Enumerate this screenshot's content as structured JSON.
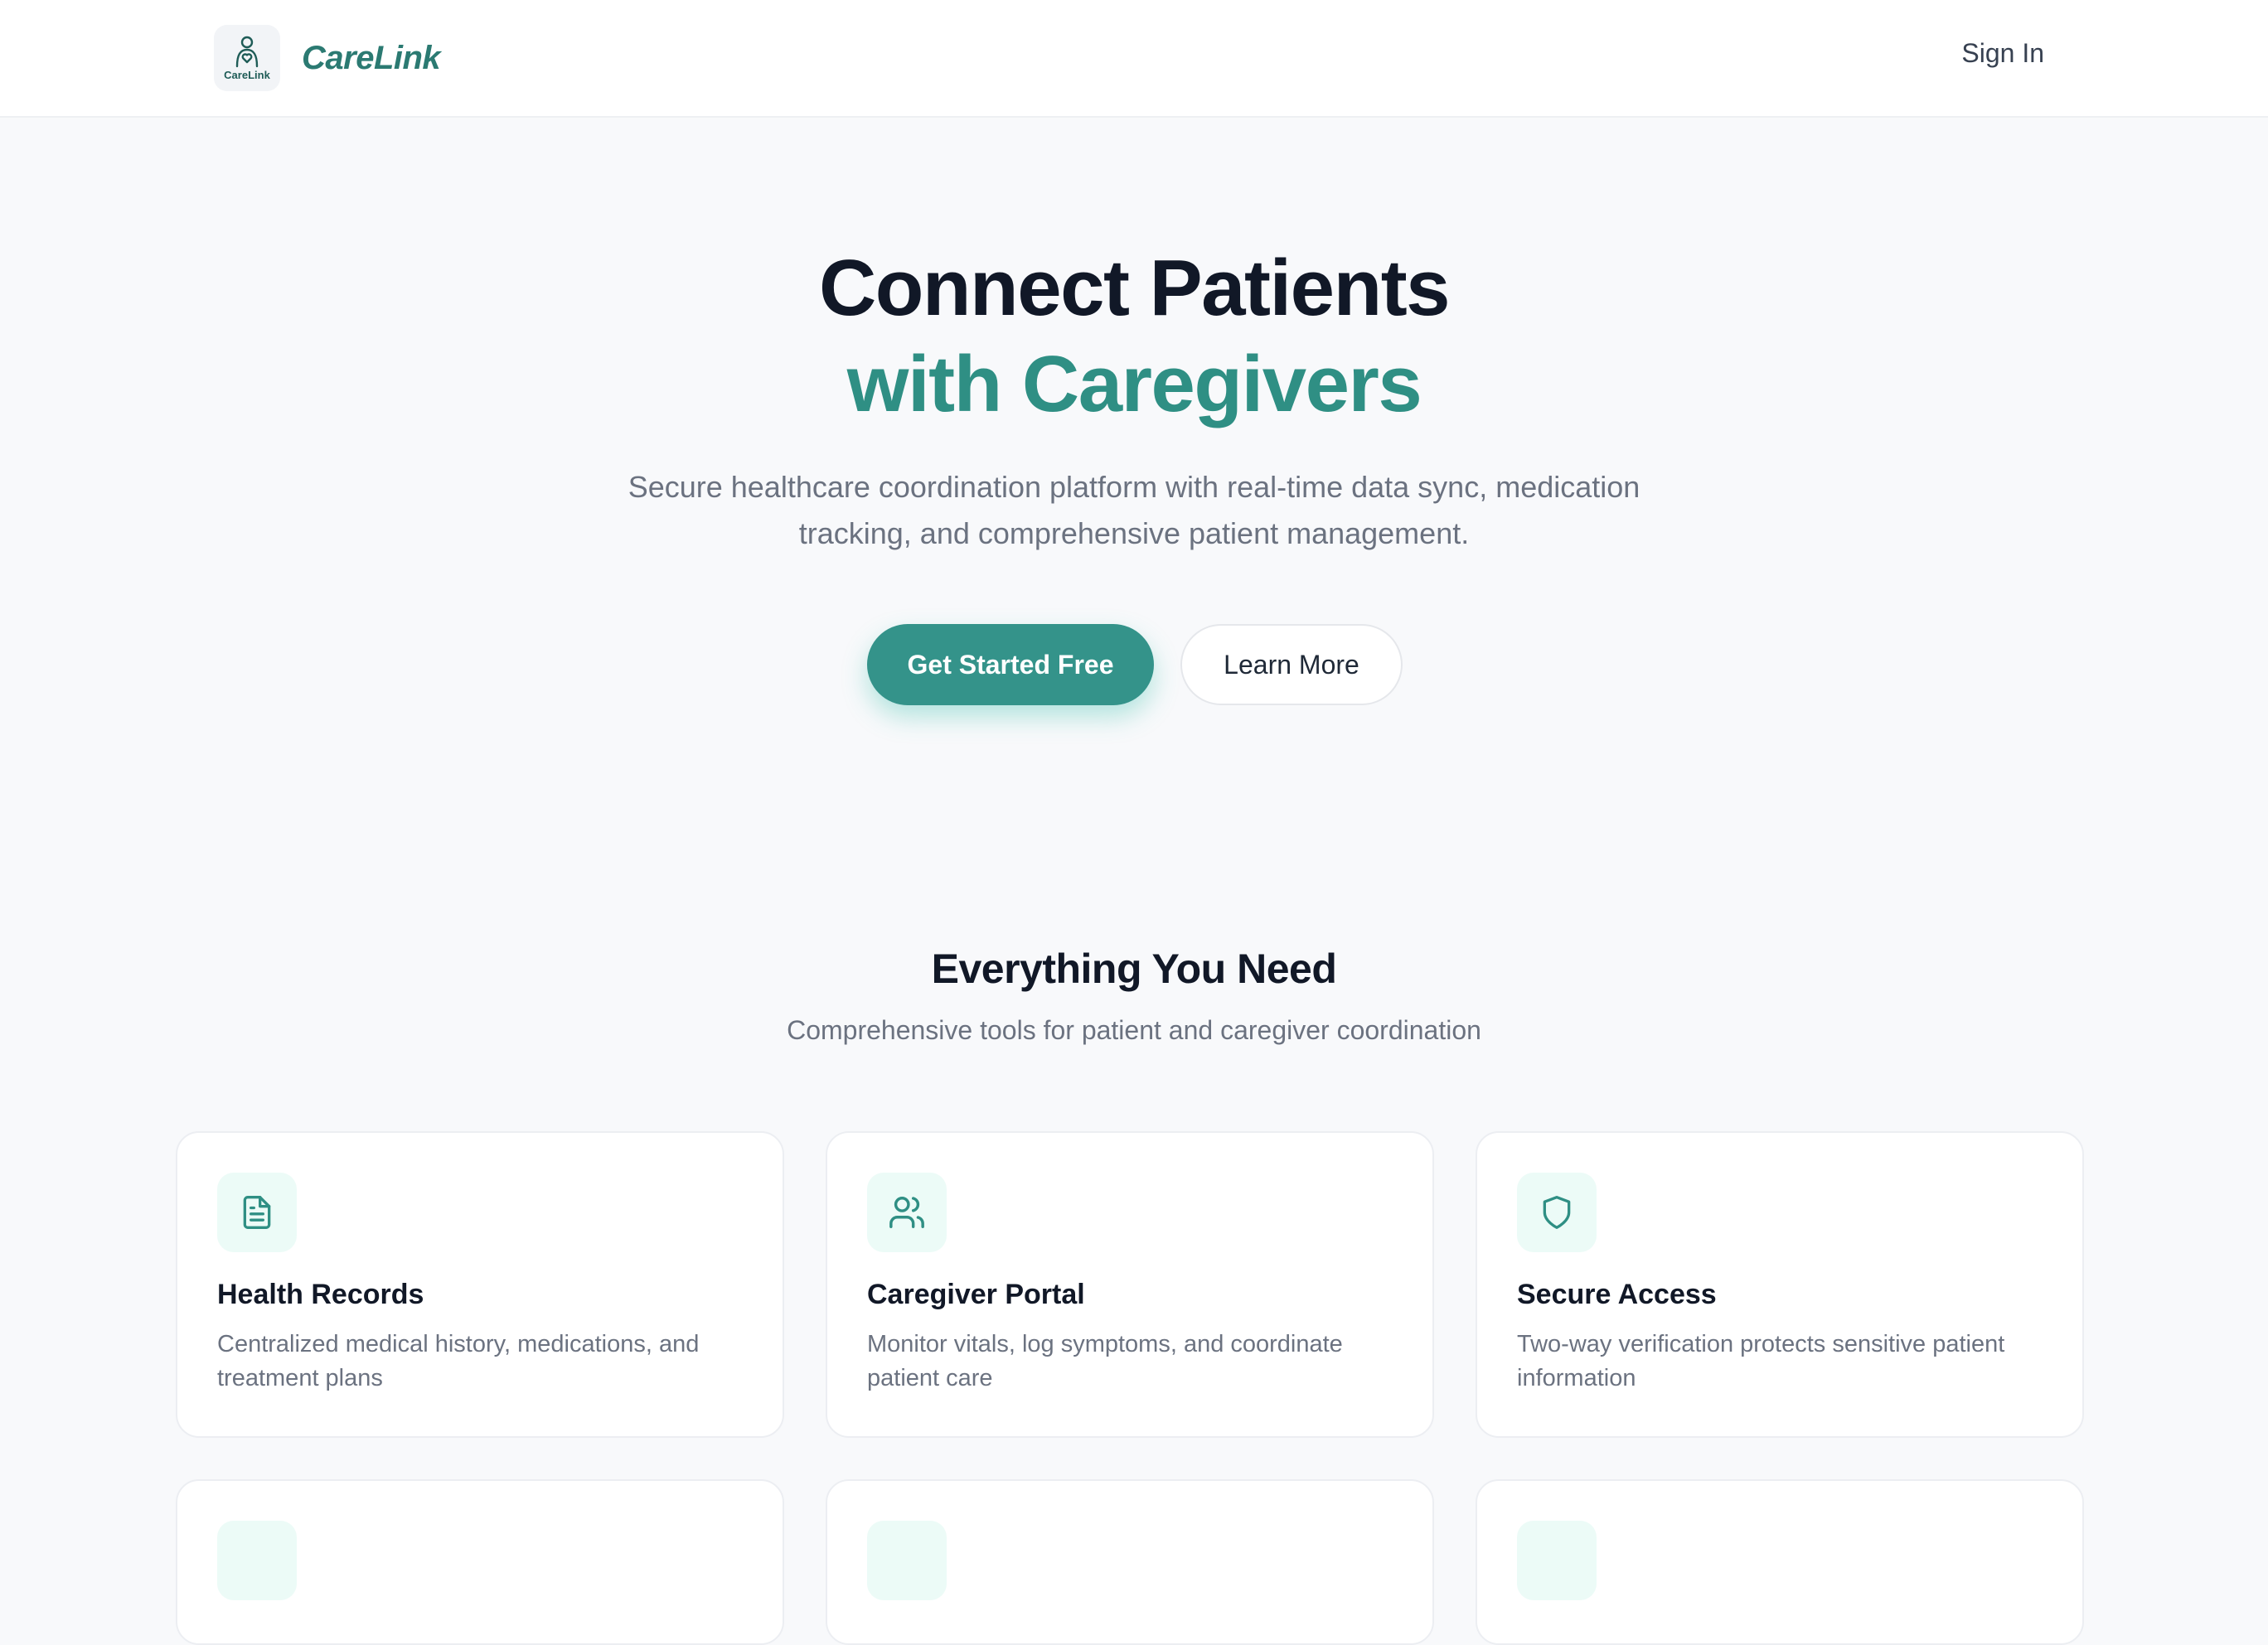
{
  "header": {
    "logo_caption": "CareLink",
    "brand_name": "CareLink",
    "signin_label": "Sign In"
  },
  "hero": {
    "title_line1": "Connect Patients",
    "title_line2": "with Caregivers",
    "subtitle": "Secure healthcare coordination platform with real-time data sync, medication tracking, and comprehensive patient management.",
    "primary_cta": "Get Started Free",
    "secondary_cta": "Learn More"
  },
  "features": {
    "title": "Everything You Need",
    "subtitle": "Comprehensive tools for patient and caregiver coordination",
    "cards": [
      {
        "icon": "document-icon",
        "title": "Health Records",
        "description": "Centralized medical history, medications, and treatment plans"
      },
      {
        "icon": "users-icon",
        "title": "Caregiver Portal",
        "description": "Monitor vitals, log symptoms, and coordinate patient care"
      },
      {
        "icon": "shield-icon",
        "title": "Secure Access",
        "description": "Two-way verification protects sensitive patient information"
      }
    ]
  },
  "colors": {
    "brand": "#2b7a72",
    "accent": "#34938a",
    "heading": "#111827",
    "muted": "#6b7280",
    "icon_bg": "#ecfbf7"
  }
}
